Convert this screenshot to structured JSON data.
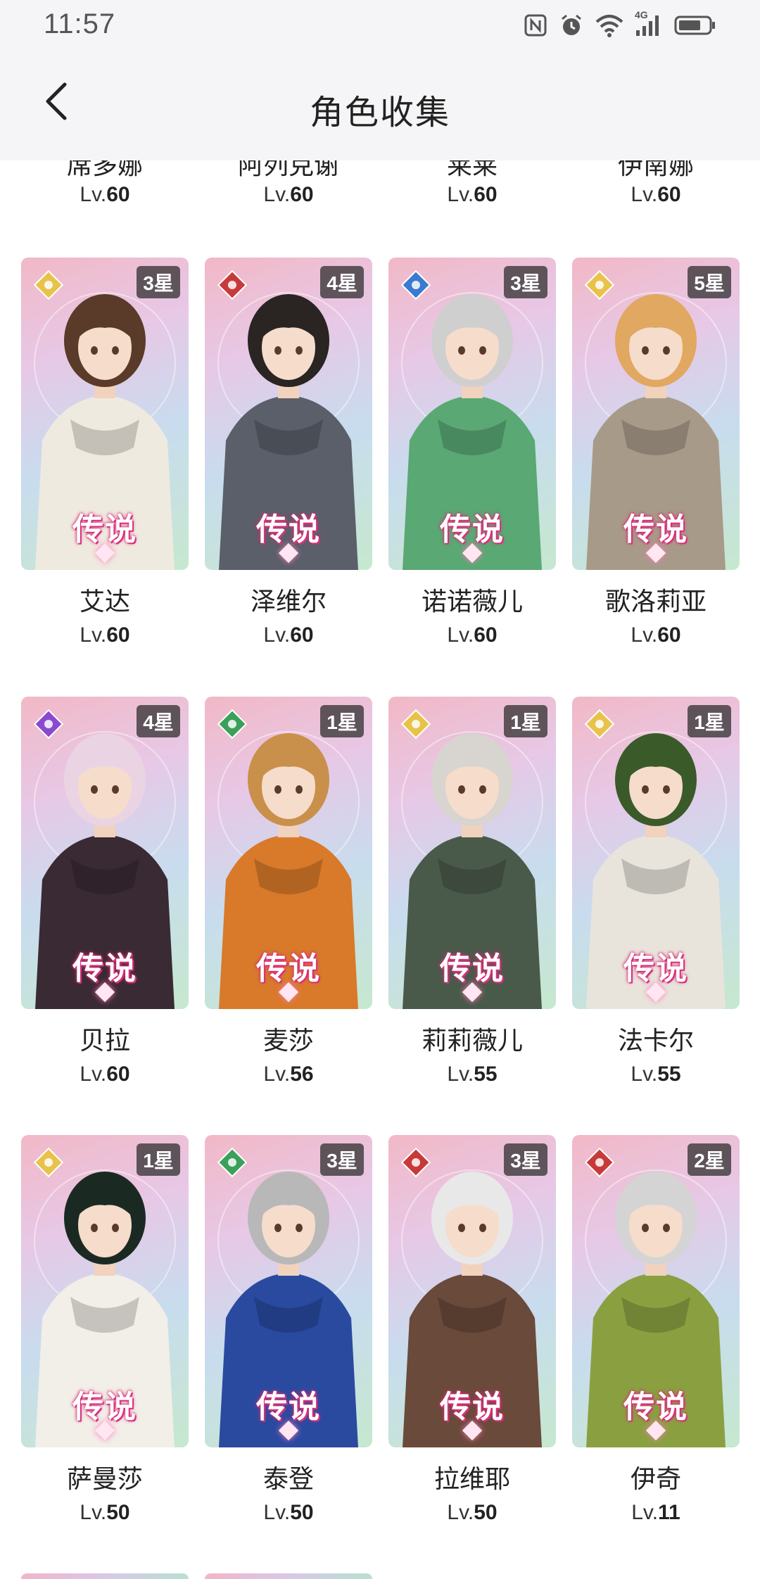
{
  "status_bar": {
    "time": "11:57",
    "network": "4G"
  },
  "header": {
    "title": "角色收集"
  },
  "top_partial_row": [
    {
      "name": "席多娜",
      "level_prefix": "Lv.",
      "level": "60"
    },
    {
      "name": "阿列克谢",
      "level_prefix": "Lv.",
      "level": "60"
    },
    {
      "name": "莱莱",
      "level_prefix": "Lv.",
      "level": "60"
    },
    {
      "name": "伊南娜",
      "level_prefix": "Lv.",
      "level": "60"
    }
  ],
  "characters": [
    {
      "name": "艾达",
      "stars": "3星",
      "rarity": "传说",
      "level_prefix": "Lv.",
      "level": "60",
      "element": "light-icon",
      "color": "#e8c24a",
      "hair": "#5a3a28",
      "outfit": "#efeae0"
    },
    {
      "name": "泽维尔",
      "stars": "4星",
      "rarity": "传说",
      "level_prefix": "Lv.",
      "level": "60",
      "element": "fire-icon",
      "color": "#c83a3a",
      "hair": "#2a2422",
      "outfit": "#5a5f6a"
    },
    {
      "name": "诺诺薇儿",
      "stars": "3星",
      "rarity": "传说",
      "level_prefix": "Lv.",
      "level": "60",
      "element": "ice-icon",
      "color": "#3a7ad0",
      "hair": "#cfcfcf",
      "outfit": "#5aa874"
    },
    {
      "name": "歌洛莉亚",
      "stars": "5星",
      "rarity": "传说",
      "level_prefix": "Lv.",
      "level": "60",
      "element": "light-icon",
      "color": "#e8c24a",
      "hair": "#e0a860",
      "outfit": "#a89a88"
    },
    {
      "name": "贝拉",
      "stars": "4星",
      "rarity": "传说",
      "level_prefix": "Lv.",
      "level": "60",
      "element": "dark-icon",
      "color": "#8a4ad0",
      "hair": "#ead4e4",
      "outfit": "#3a2a34"
    },
    {
      "name": "麦莎",
      "stars": "1星",
      "rarity": "传说",
      "level_prefix": "Lv.",
      "level": "56",
      "element": "wind-icon",
      "color": "#3aa05a",
      "hair": "#c8904a",
      "outfit": "#d87a2a"
    },
    {
      "name": "莉莉薇儿",
      "stars": "1星",
      "rarity": "传说",
      "level_prefix": "Lv.",
      "level": "55",
      "element": "light-icon",
      "color": "#e8c24a",
      "hair": "#d8d4d0",
      "outfit": "#4a5a4a"
    },
    {
      "name": "法卡尔",
      "stars": "1星",
      "rarity": "传说",
      "level_prefix": "Lv.",
      "level": "55",
      "element": "light-icon",
      "color": "#e8c24a",
      "hair": "#3a5a2a",
      "outfit": "#e8e4dc"
    },
    {
      "name": "萨曼莎",
      "stars": "1星",
      "rarity": "传说",
      "level_prefix": "Lv.",
      "level": "50",
      "element": "light-icon",
      "color": "#e8c24a",
      "hair": "#1a2a22",
      "outfit": "#f2eee8"
    },
    {
      "name": "泰登",
      "stars": "3星",
      "rarity": "传说",
      "level_prefix": "Lv.",
      "level": "50",
      "element": "wind-icon",
      "color": "#3aa05a",
      "hair": "#b8b8b8",
      "outfit": "#2a4aa0"
    },
    {
      "name": "拉维耶",
      "stars": "3星",
      "rarity": "传说",
      "level_prefix": "Lv.",
      "level": "50",
      "element": "fire-icon",
      "color": "#c83a3a",
      "hair": "#e8e8e8",
      "outfit": "#6a4a3a"
    },
    {
      "name": "伊奇",
      "stars": "2星",
      "rarity": "传说",
      "level_prefix": "Lv.",
      "level": "11",
      "element": "fire-icon",
      "color": "#c83a3a",
      "hair": "#d4d4d4",
      "outfit": "#8aa040"
    }
  ]
}
